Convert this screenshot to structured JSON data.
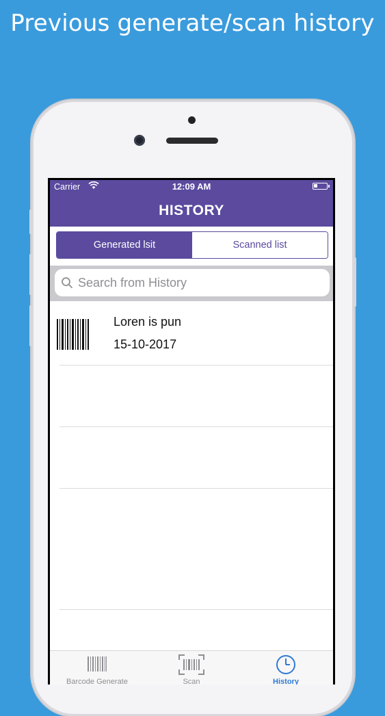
{
  "headline": "Previous generate/scan history",
  "status": {
    "carrier": "Carrier",
    "time": "12:09 AM"
  },
  "nav": {
    "title": "HISTORY"
  },
  "segments": [
    {
      "label": "Generated lsit",
      "selected": true
    },
    {
      "label": "Scanned list",
      "selected": false
    }
  ],
  "search": {
    "placeholder": "Search from History"
  },
  "history": [
    {
      "title": "Loren is pun",
      "date": "15-10-2017",
      "icon": "barcode-icon"
    }
  ],
  "tabs": [
    {
      "label": "Barcode Generate",
      "icon": "barcode-icon",
      "active": false
    },
    {
      "label": "Scan",
      "icon": "scan-icon",
      "active": false
    },
    {
      "label": "History",
      "icon": "clock-icon",
      "active": true
    }
  ],
  "colors": {
    "background": "#3A9BDC",
    "accent": "#5B4A9E",
    "tab_active": "#2f7ad6"
  }
}
